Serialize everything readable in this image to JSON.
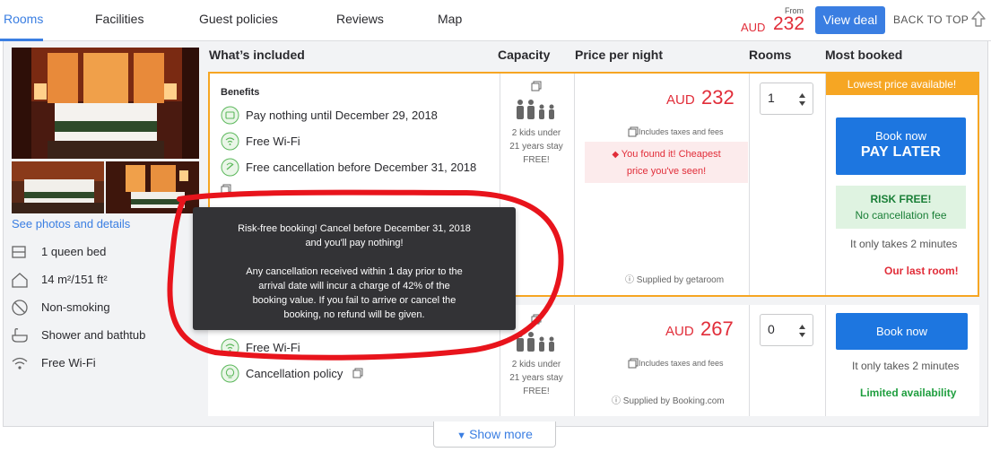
{
  "nav": {
    "tabs": [
      "Rooms",
      "Facilities",
      "Guest policies",
      "Reviews",
      "Map"
    ],
    "from_label": "From",
    "currency": "AUD",
    "price": "232",
    "view_deal": "View deal",
    "back_to_top": "BACK TO TOP"
  },
  "room": {
    "see_photos": "See photos and details",
    "amenities": [
      "1 queen bed",
      "14 m²/151 ft²",
      "Non-smoking",
      "Shower and bathtub",
      "Free Wi-Fi"
    ]
  },
  "columns": [
    "What’s included",
    "Capacity",
    "Price per night",
    "Rooms",
    "Most booked"
  ],
  "offers": [
    {
      "benefits_title": "Benefits",
      "benefits": [
        "Pay nothing until December 29, 2018",
        "Free Wi-Fi",
        "Free cancellation before December 31, 2018"
      ],
      "capacity": [
        "2 kids under",
        "21 years stay",
        "FREE!"
      ],
      "currency": "AUD",
      "price": "232",
      "includes_taxes": "Includes taxes and fees",
      "cheapest_line1": "You found it! Cheapest",
      "cheapest_line2": "price you've seen!",
      "supplied_by": "Supplied by getaroom",
      "rooms_selected": "1",
      "banner": "Lowest price available!",
      "book_top": "Book now",
      "book_bottom": "PAY LATER",
      "risk_free_title": "RISK FREE!",
      "risk_free_sub": "No cancellation fee",
      "takes": "It only takes 2 minutes",
      "status": "Our last room!"
    },
    {
      "benefits": [
        "Free Wi-Fi",
        "Cancellation policy"
      ],
      "capacity": [
        "2 kids under",
        "21 years stay",
        "FREE!"
      ],
      "currency": "AUD",
      "price": "267",
      "includes_taxes": "Includes taxes and fees",
      "supplied_by": "Supplied by Booking.com",
      "rooms_selected": "0",
      "book": "Book now",
      "takes": "It only takes 2 minutes",
      "status": "Limited availability"
    }
  ],
  "tooltip": {
    "line1": "Risk-free booking! Cancel before December 31, 2018",
    "line2": "and you'll pay nothing!",
    "line3": "Any cancellation received within 1 day prior to the",
    "line4": "arrival date will incur a charge of 42% of the",
    "line5": "booking value. If you fail to arrive or cancel the",
    "line6": "booking, no refund will be given."
  },
  "show_more": "Show more",
  "colors": {
    "accent": "#3a7ee2",
    "book_button": "#1d76e0",
    "price_red": "#e12d39",
    "highlight_orange": "#f6a623",
    "annotation_red": "#e8141c"
  }
}
